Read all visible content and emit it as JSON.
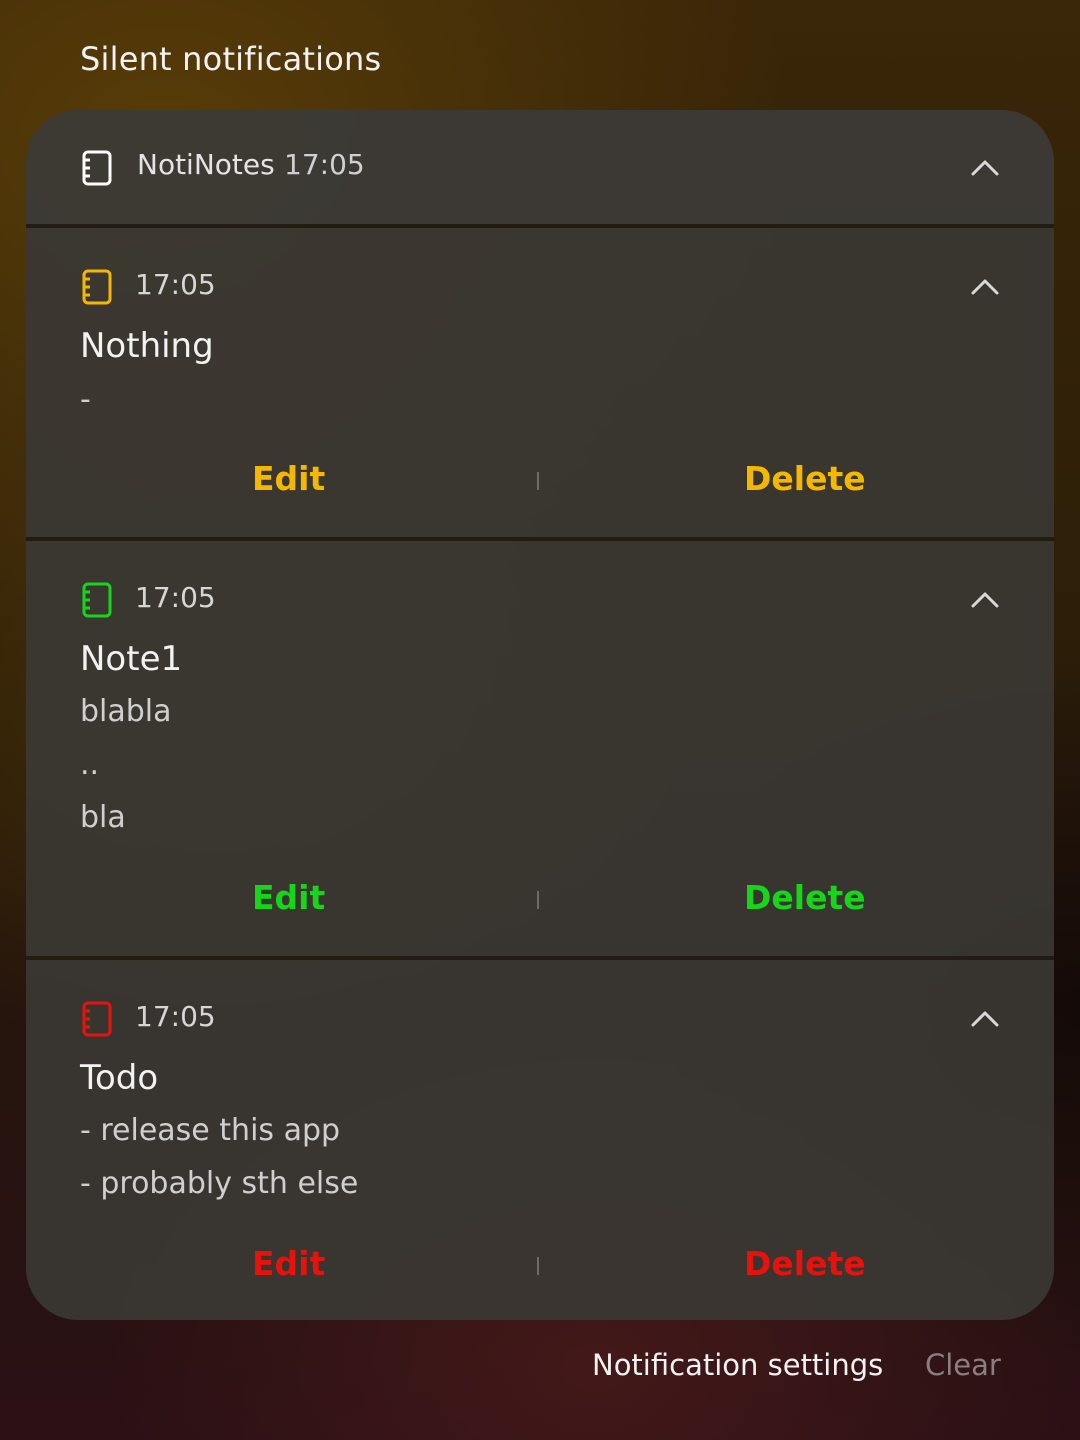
{
  "section_title": "Silent notifications",
  "group": {
    "app_name": "NotiNotes",
    "time": "17:05",
    "icon": "notebook-icon",
    "icon_color": "#ffffff"
  },
  "notes": [
    {
      "time": "17:05",
      "title": "Nothing",
      "lines": [
        "-"
      ],
      "accent": "#f5b800",
      "icon": "notebook-icon",
      "edit_label": "Edit",
      "delete_label": "Delete"
    },
    {
      "time": "17:05",
      "title": "Note1",
      "lines": [
        "blabla",
        "..",
        "bla"
      ],
      "accent": "#17d61a",
      "icon": "notebook-icon",
      "edit_label": "Edit",
      "delete_label": "Delete"
    },
    {
      "time": "17:05",
      "title": "Todo",
      "lines": [
        "- release this app",
        "- probably sth else"
      ],
      "accent": "#e8120c",
      "icon": "notebook-icon",
      "edit_label": "Edit",
      "delete_label": "Delete"
    }
  ],
  "footer": {
    "settings_label": "Notification settings",
    "clear_label": "Clear",
    "settings_color": "#f2f2f2",
    "clear_color": "#8a7f80"
  }
}
